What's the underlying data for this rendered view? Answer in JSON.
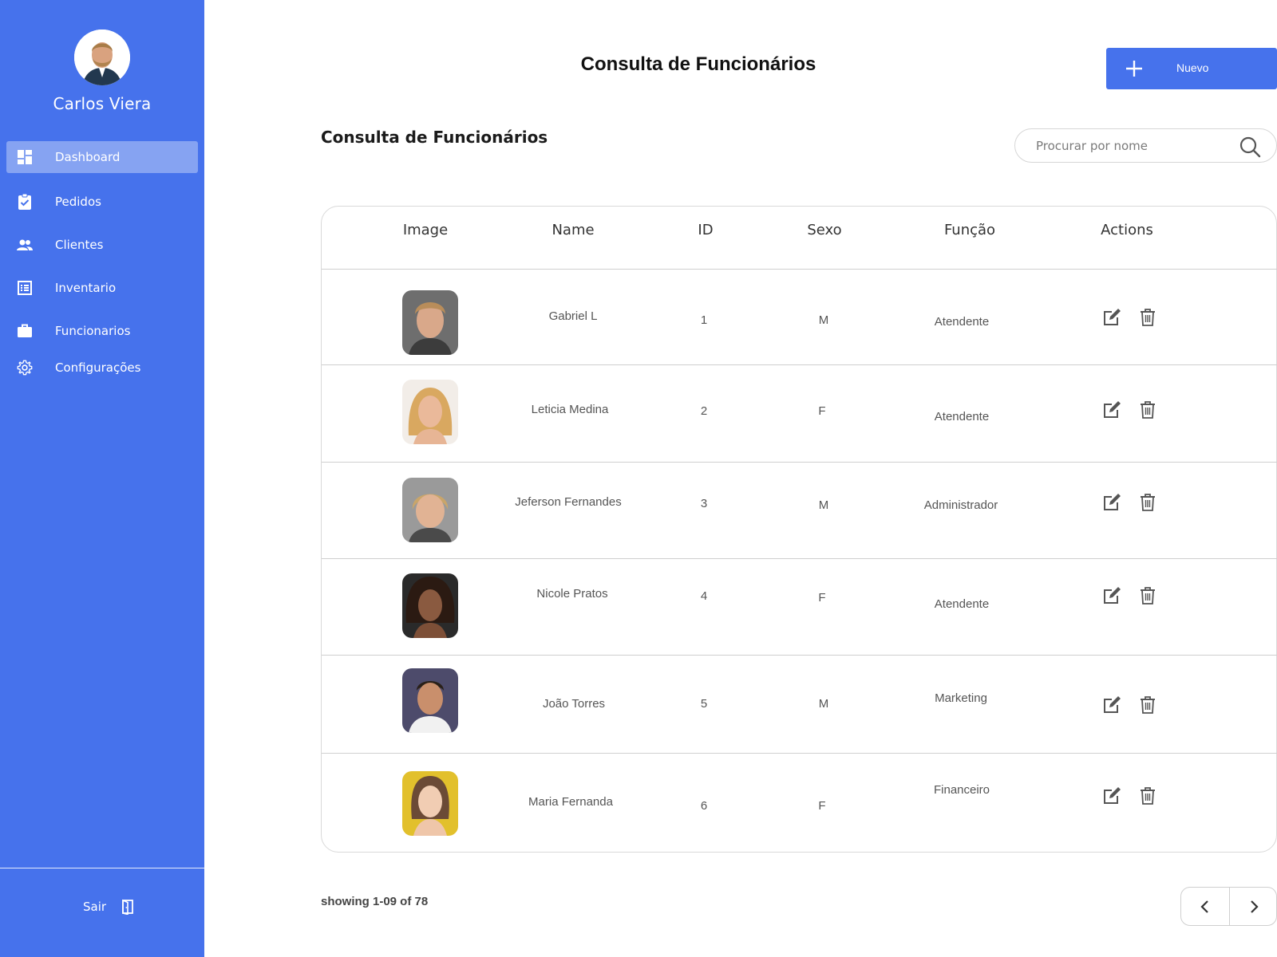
{
  "user": {
    "name": "Carlos Viera"
  },
  "sidebar": {
    "items": [
      {
        "label": "Dashboard",
        "icon": "dashboard-icon",
        "active": true
      },
      {
        "label": "Pedidos",
        "icon": "clipboard-check-icon"
      },
      {
        "label": "Clientes",
        "icon": "people-icon"
      },
      {
        "label": "Inventario",
        "icon": "list-icon"
      },
      {
        "label": "Funcionarios",
        "icon": "briefcase-icon"
      },
      {
        "label": "Configurações",
        "icon": "gear-icon"
      }
    ],
    "logout_label": "Sair",
    "background": "#4672EC"
  },
  "header": {
    "title": "Consulta de Funcionários",
    "new_button_label": "Nuevo"
  },
  "section": {
    "title": "Consulta de Funcionários"
  },
  "search": {
    "placeholder": "Procurar por nome"
  },
  "table": {
    "columns": [
      "Image",
      "Name",
      "ID",
      "Sexo",
      "Função",
      "Actions"
    ],
    "rows": [
      {
        "name": "Gabriel L",
        "id": "1",
        "sexo": "M",
        "funcao": "Atendente",
        "photo_color": "#b98d6e"
      },
      {
        "name": "Leticia Medina",
        "id": "2",
        "sexo": "F",
        "funcao": "Atendente",
        "photo_color": "#d4a86b"
      },
      {
        "name": "Jeferson Fernandes",
        "id": "3",
        "sexo": "M",
        "funcao": "Administrador",
        "photo_color": "#c59a73"
      },
      {
        "name": "Nicole Pratos",
        "id": "4",
        "sexo": "F",
        "funcao": "Atendente",
        "photo_color": "#5b3526"
      },
      {
        "name": "João Torres",
        "id": "5",
        "sexo": "M",
        "funcao": "Marketing",
        "photo_color": "#4d4b6b"
      },
      {
        "name": "Maria Fernanda",
        "id": "6",
        "sexo": "F",
        "funcao": "Financeiro",
        "photo_color": "#e2c02c"
      }
    ]
  },
  "footer": {
    "showing": "showing 1-09 of 78"
  },
  "colors": {
    "accent": "#4672EC",
    "icon": "#555555"
  }
}
